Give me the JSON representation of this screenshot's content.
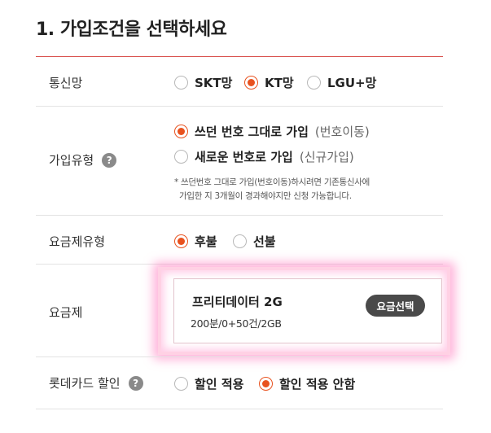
{
  "title": "1. 가입조건을 선택하세요",
  "network": {
    "label": "통신망",
    "options": [
      "SKT망",
      "KT망",
      "LGU+망"
    ],
    "selected": "KT망"
  },
  "join_type": {
    "label": "가입유형",
    "help": "?",
    "options": [
      {
        "main": "쓰던 번호 그대로 가입",
        "paren": "(번호이동)"
      },
      {
        "main": "새로운 번호로 가입",
        "paren": "(신규가입)"
      }
    ],
    "selected": "쓰던 번호 그대로 가입",
    "note_line1": "* 쓰던번호 그대로 가입(번호이동)하시려면 기존통신사에",
    "note_line2": "가입한 지 3개월이 경과해야지만 신청 가능합니다."
  },
  "plan_type": {
    "label": "요금제유형",
    "options": [
      "후불",
      "선불"
    ],
    "selected": "후불"
  },
  "plan": {
    "label": "요금제",
    "name": "프리티데이터 2G",
    "desc": "200분/0+50건/2GB",
    "button": "요금선택"
  },
  "lotte_card": {
    "label": "롯데카드 할인",
    "help": "?",
    "options": [
      "할인 적용",
      "할인 적용 안함"
    ],
    "selected": "할인 적용 안함"
  },
  "colors": {
    "accent": "#e8521f",
    "divider_title": "#d9534f",
    "glow": "#ff78be",
    "button_bg": "#4a4a4a"
  }
}
